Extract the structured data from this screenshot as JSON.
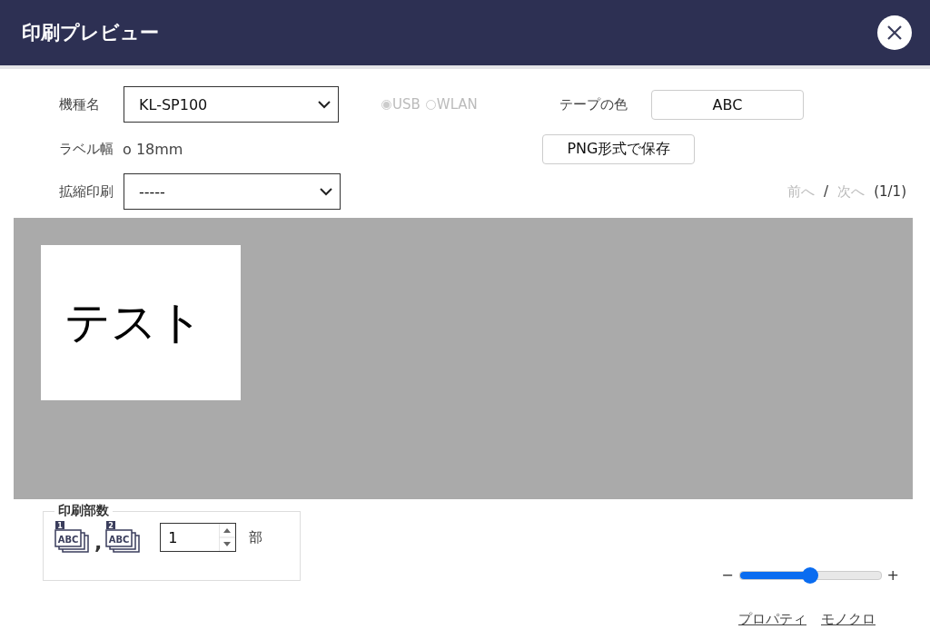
{
  "window": {
    "title": "印刷プレビュー"
  },
  "form": {
    "model_label": "機種名",
    "model_value": "KL-SP100",
    "connection_disabled": true,
    "connection": [
      {
        "label": "USB",
        "selected": true
      },
      {
        "label": "WLAN",
        "selected": false
      }
    ],
    "tape_color_label": "テープの色",
    "tape_color_button": "ABC",
    "label_width_label": "ラベル幅",
    "label_width_value": "o 18mm",
    "png_button": "PNG形式で保存",
    "scale_label": "拡縮印刷",
    "scale_value": "-----"
  },
  "pager": {
    "prev": {
      "label": "前へ",
      "disabled": true
    },
    "separator": "/",
    "next": {
      "label": "次へ",
      "disabled": true
    },
    "count": "(1/1)"
  },
  "preview": {
    "labels": [
      {
        "text": "テスト"
      }
    ]
  },
  "copies": {
    "legend": "印刷部数",
    "collate_icons": [
      {
        "badge": "1",
        "text": "ABC"
      },
      {
        "badge": "2",
        "text": "ABC"
      }
    ],
    "separator": ",",
    "value": "1",
    "unit": "部"
  },
  "zoom": {
    "minus": "−",
    "plus": "+",
    "level": 0.5
  },
  "links": [
    "プロパティ",
    "モノクロ"
  ]
}
